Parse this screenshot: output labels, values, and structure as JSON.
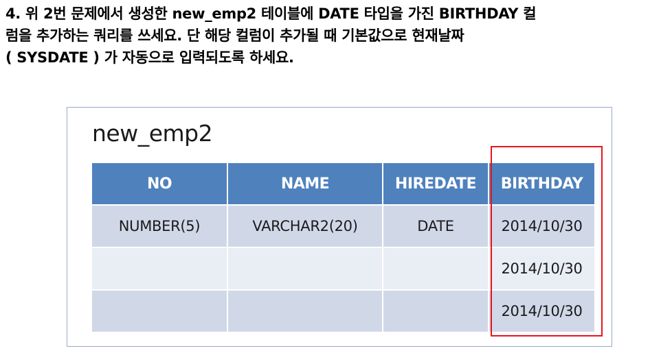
{
  "question": {
    "lines": [
      "4. 위 2번 문제에서 생성한 new_emp2 테이블에 DATE 타입을 가진 BIRTHDAY 컬",
      "럼을 추가하는 쿼리를 쓰세요. 단 해당 컬럼이 추가될 때 기본값으로 현재날짜",
      "( SYSDATE ) 가 자동으로 입력되도록 하세요."
    ]
  },
  "table": {
    "name": "new_emp2",
    "headers": [
      "NO",
      "NAME",
      "HIREDATE",
      "BIRTHDAY"
    ],
    "rows": [
      [
        "NUMBER(5)",
        "VARCHAR2(20)",
        "DATE",
        "2014/10/30"
      ],
      [
        "",
        "",
        "",
        "2014/10/30"
      ],
      [
        "",
        "",
        "",
        "2014/10/30"
      ]
    ]
  },
  "colors": {
    "header_bg": "#4f81bd",
    "row_dark": "#d0d8e8",
    "row_light": "#e9edf4",
    "highlight_border": "#e8141c"
  }
}
